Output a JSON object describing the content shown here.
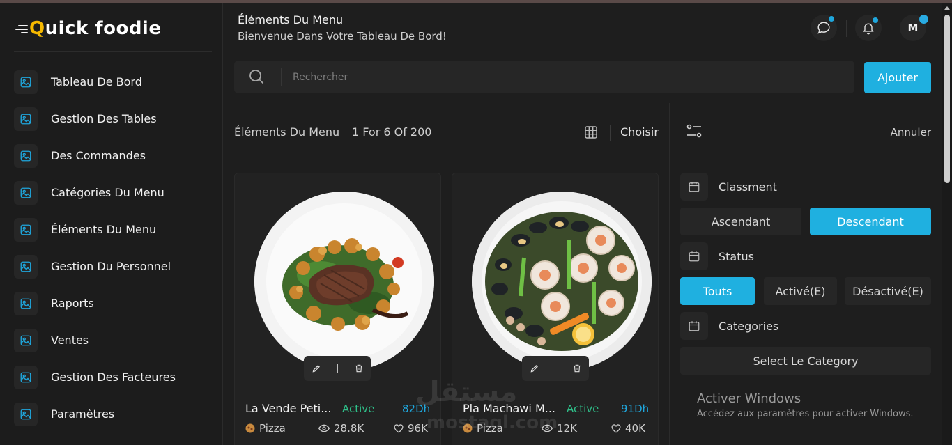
{
  "app": {
    "logo_text_q": "Q",
    "logo_text_rest": "uick foodie"
  },
  "sidebar": {
    "items": [
      {
        "label": "Tableau De Bord"
      },
      {
        "label": "Gestion Des Tables"
      },
      {
        "label": "Des Commandes"
      },
      {
        "label": "Catégories Du Menu"
      },
      {
        "label": "Éléments Du Menu"
      },
      {
        "label": "Gestion Du Personnel"
      },
      {
        "label": "Raports"
      },
      {
        "label": "Ventes"
      },
      {
        "label": "Gestion Des Facteures"
      },
      {
        "label": "Paramètres"
      }
    ]
  },
  "header": {
    "title": "Éléments Du Menu",
    "subtitle": "Bienvenue Dans Votre Tableau De Bord!",
    "avatar_initial": "M"
  },
  "search": {
    "placeholder": "Rechercher",
    "value": ""
  },
  "add_button": "Ajouter",
  "toolbar": {
    "title": "Éléments Du Menu",
    "count": "1 For 6 Of 200",
    "choose_label": "Choisir"
  },
  "cards": [
    {
      "name": "La Vende Peti...",
      "status": "Active",
      "price": "82Dh",
      "category": "Pizza",
      "views": "28.8K",
      "likes": "96K"
    },
    {
      "name": "Pla Machawi M...",
      "status": "Active",
      "price": "91Dh",
      "category": "Pizza",
      "views": "12K",
      "likes": "40K"
    }
  ],
  "filter": {
    "cancel_label": "Annuler",
    "sort_label": "Classment",
    "sort_options": [
      "Ascendant",
      "Descendant"
    ],
    "sort_selected": "Descendant",
    "status_label": "Status",
    "status_options": [
      "Touts",
      "Activé(E)",
      "Désactivé(E)"
    ],
    "status_selected": "Touts",
    "categories_label": "Categories",
    "category_select": "Select Le Category"
  },
  "windows_notice": {
    "title": "Activer Windows",
    "subtitle": "Accédez aux paramètres pour activer Windows."
  },
  "watermark": {
    "arabic": "مستقل",
    "latin": "mostaql.com"
  },
  "colors": {
    "accent": "#1fb0e0",
    "active_status": "#2fc08a",
    "price": "#1fa7dd",
    "logo_q": "#f5b800",
    "background": "#1e1e1e"
  }
}
